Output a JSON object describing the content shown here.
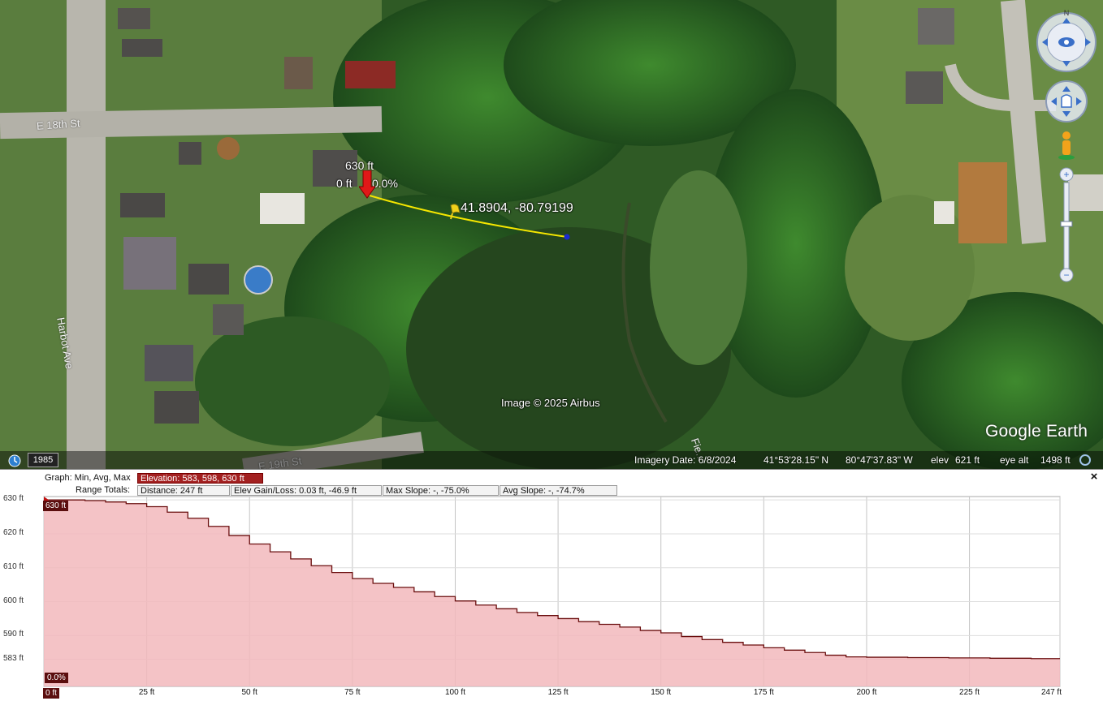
{
  "map": {
    "streets": [
      "E 18th St",
      "Harbot Ave",
      "E 19th St",
      "Fie..."
    ],
    "marker_label": "41.8904, -80.79199",
    "cursor_readout": {
      "elevation": "630 ft",
      "distance": "0 ft",
      "slope": "0.0%"
    },
    "attribution": "Image © 2025 Airbus",
    "logo": "Google Earth",
    "historical_year": "1985",
    "status": {
      "imagery_date": "Imagery Date: 6/8/2024",
      "lat": "41°53'28.15\" N",
      "lon": "80°47'37.83\" W",
      "elev_label": "elev",
      "elev_value": "621 ft",
      "eye_label": "eye alt",
      "eye_value": "1498 ft"
    },
    "colors": {
      "path": "#f5e600",
      "marker": "#e01818",
      "pin": "#f2d21b"
    }
  },
  "profile": {
    "graph_label": "Graph: Min, Avg, Max",
    "elevation_box": "Elevation: 583, 598, 630 ft",
    "range_label": "Range Totals:",
    "distance_box": "Distance: 247 ft",
    "gain_box": "Elev Gain/Loss: 0.03 ft, -46.9 ft",
    "max_slope_box": "Max Slope: -, -75.0%",
    "avg_slope_box": "Avg Slope: -, -74.7%",
    "close_glyph": "×",
    "max_tag": "630 ft",
    "slope_tag": "0.0%",
    "start_tag": "0 ft",
    "fill_color": "#f2b8bc"
  },
  "chart_data": {
    "type": "area",
    "x": [
      0,
      5,
      10,
      15,
      20,
      25,
      30,
      35,
      40,
      45,
      50,
      55,
      60,
      65,
      70,
      75,
      80,
      85,
      90,
      95,
      100,
      105,
      110,
      115,
      120,
      125,
      130,
      135,
      140,
      145,
      150,
      155,
      160,
      165,
      170,
      175,
      180,
      185,
      190,
      195,
      200,
      210,
      220,
      230,
      240,
      247
    ],
    "values": [
      630,
      630,
      629.8,
      629.4,
      628.9,
      628,
      626.4,
      624.6,
      622.2,
      619.5,
      617,
      614.7,
      612.6,
      610.6,
      608.6,
      606.8,
      605.4,
      604.2,
      602.9,
      601.5,
      600.2,
      599,
      597.9,
      596.8,
      595.9,
      595,
      594.1,
      593.3,
      592.5,
      591.5,
      590.8,
      589.7,
      588.8,
      588,
      587.2,
      586.4,
      585.7,
      585,
      584.2,
      583.7,
      583.6,
      583.5,
      583.4,
      583.3,
      583.2,
      583.2
    ],
    "xlabel": "",
    "ylabel": "",
    "xlim": [
      0,
      247
    ],
    "ylim": [
      575,
      631
    ],
    "x_ticks": [
      0,
      25,
      50,
      75,
      100,
      125,
      150,
      175,
      200,
      225,
      247
    ],
    "x_tick_labels": [
      "0 ft",
      "25 ft",
      "50 ft",
      "75 ft",
      "100 ft",
      "125 ft",
      "150 ft",
      "175 ft",
      "200 ft",
      "225 ft",
      "247 ft"
    ],
    "y_ticks": [
      630,
      620,
      610,
      600,
      590,
      583
    ],
    "y_tick_labels": [
      "630 ft",
      "620 ft",
      "610 ft",
      "600 ft",
      "590 ft",
      "583 ft"
    ],
    "grid": true
  }
}
